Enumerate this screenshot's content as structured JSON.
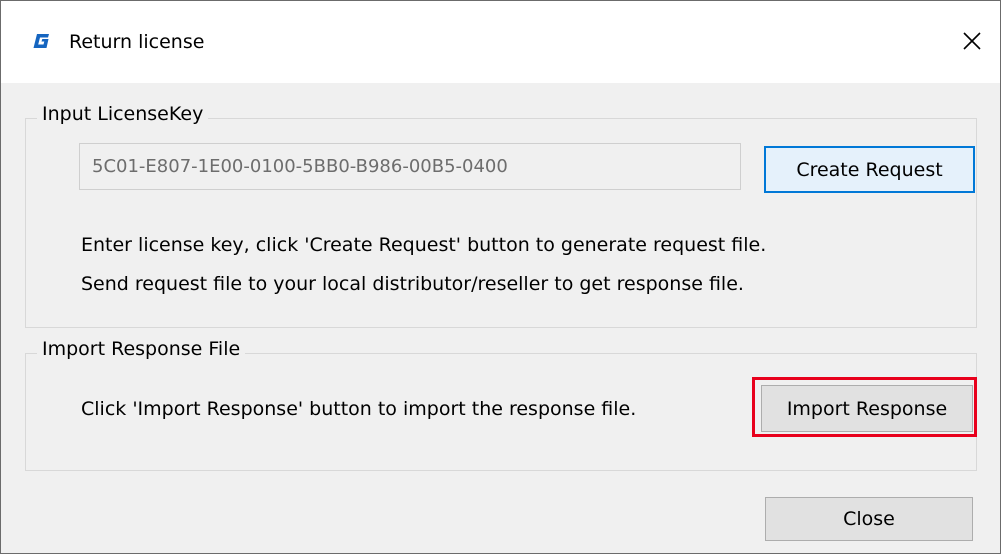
{
  "window": {
    "title": "Return license",
    "close_glyph": "✕",
    "app_icon": "gstarcad-g-icon",
    "accent_color": "#0078d7",
    "highlight_color": "#e8001c"
  },
  "license_group": {
    "label": "Input LicenseKey",
    "license_key_value": "5C01-E807-1E00-0100-5BB0-B986-00B5-0400",
    "create_request_label": "Create Request",
    "instruction_1": "Enter license key, click 'Create Request' button to generate request file.",
    "instruction_2": "Send request file to your local distributor/reseller to get response file."
  },
  "response_group": {
    "label": "Import Response File",
    "instruction": "Click 'Import Response' button to import the response file.",
    "import_response_label": "Import Response"
  },
  "footer": {
    "close_label": "Close"
  }
}
